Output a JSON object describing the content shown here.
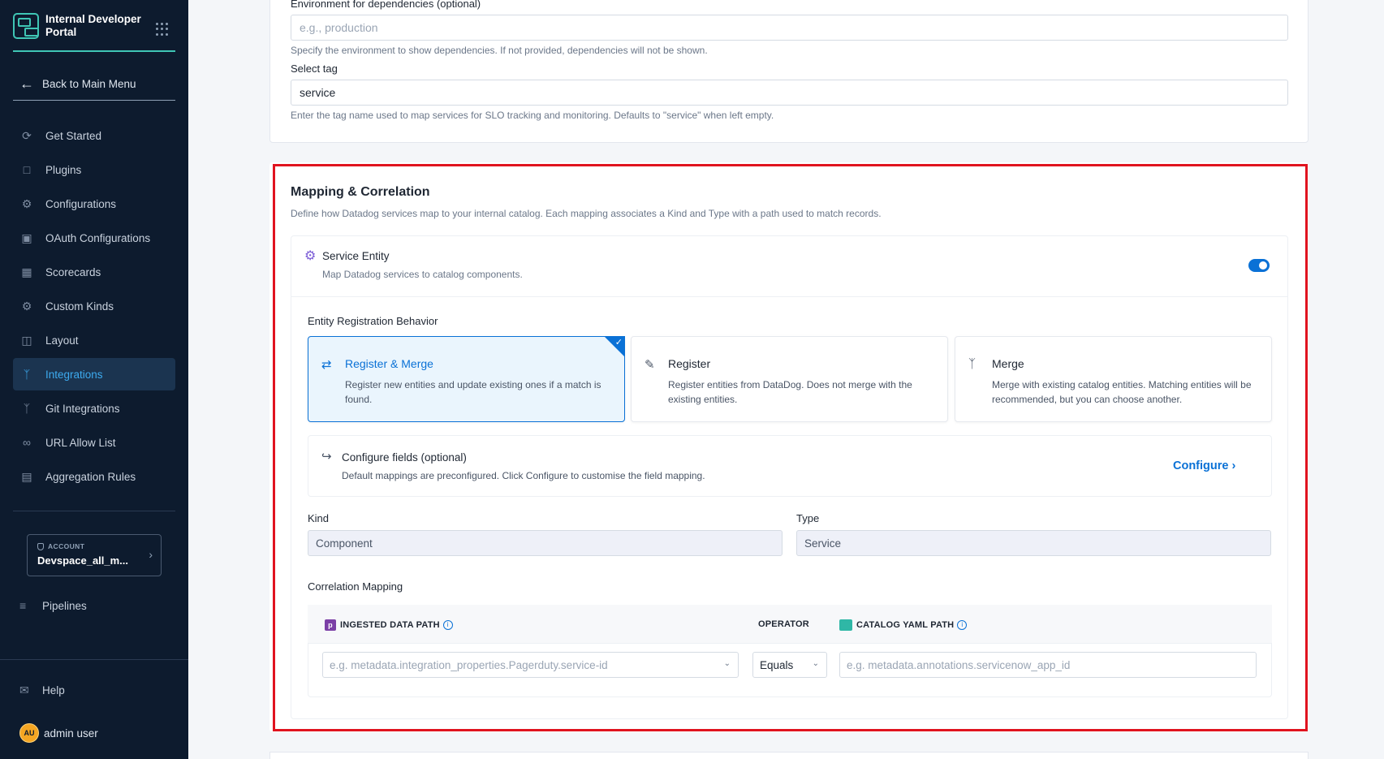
{
  "sidebar": {
    "brand_title": "Internal Developer Portal",
    "back_label": "Back to Main Menu",
    "items": [
      {
        "label": "Get Started",
        "icon": "get-started-icon"
      },
      {
        "label": "Plugins",
        "icon": "plugins-icon"
      },
      {
        "label": "Configurations",
        "icon": "configurations-icon"
      },
      {
        "label": "OAuth Configurations",
        "icon": "lock-icon"
      },
      {
        "label": "Scorecards",
        "icon": "scorecards-icon"
      },
      {
        "label": "Custom Kinds",
        "icon": "gear-icon"
      },
      {
        "label": "Layout",
        "icon": "layout-icon"
      },
      {
        "label": "Integrations",
        "icon": "integrations-icon",
        "active": true
      },
      {
        "label": "Git Integrations",
        "icon": "git-icon"
      },
      {
        "label": "URL Allow List",
        "icon": "link-icon"
      },
      {
        "label": "Aggregation Rules",
        "icon": "aggregation-icon"
      }
    ],
    "account_label": "ACCOUNT",
    "account_name": "Devspace_all_m...",
    "pipelines_label": "Pipelines",
    "help_label": "Help",
    "user_initials": "AU",
    "user_name": "admin user"
  },
  "top_card": {
    "env_label": "Environment for dependencies (optional)",
    "env_placeholder": "e.g., production",
    "env_hint": "Specify the environment to show dependencies. If not provided, dependencies will not be shown.",
    "tag_label": "Select tag",
    "tag_value": "service",
    "tag_hint": "Enter the tag name used to map services for SLO tracking and monitoring. Defaults to \"service\" when left empty."
  },
  "mapping": {
    "title": "Mapping & Correlation",
    "description": "Define how Datadog services map to your internal catalog. Each mapping associates a Kind and Type with a path used to match records.",
    "entity_title": "Service Entity",
    "entity_subtitle": "Map Datadog services to catalog components.",
    "entity_enabled": true,
    "erb_label": "Entity Registration Behavior",
    "options": [
      {
        "title": "Register & Merge",
        "desc": "Register new entities and update existing ones if a match is found.",
        "selected": true
      },
      {
        "title": "Register",
        "desc": "Register entities from DataDog. Does not merge with the existing entities.",
        "selected": false
      },
      {
        "title": "Merge",
        "desc": "Merge with existing catalog entities. Matching entities will be recommended, but you can choose another.",
        "selected": false
      }
    ],
    "configure_title": "Configure fields (optional)",
    "configure_desc": "Default mappings are preconfigured. Click Configure to customise the field mapping.",
    "configure_link": "Configure",
    "kind_label": "Kind",
    "kind_value": "Component",
    "type_label": "Type",
    "type_value": "Service",
    "correlation_label": "Correlation Mapping",
    "col_ingested": "INGESTED DATA PATH",
    "col_operator": "OPERATOR",
    "col_catalog": "CATALOG YAML PATH",
    "ingested_placeholder": "e.g. metadata.integration_properties.Pagerduty.service-id",
    "operator_value": "Equals",
    "catalog_placeholder": "e.g. metadata.annotations.servicenow_app_id"
  },
  "colors": {
    "sidebar_bg": "#0d1b2e",
    "accent": "#0a71d6",
    "brand_teal": "#3fc6b5",
    "highlight_border": "#e0131f"
  }
}
